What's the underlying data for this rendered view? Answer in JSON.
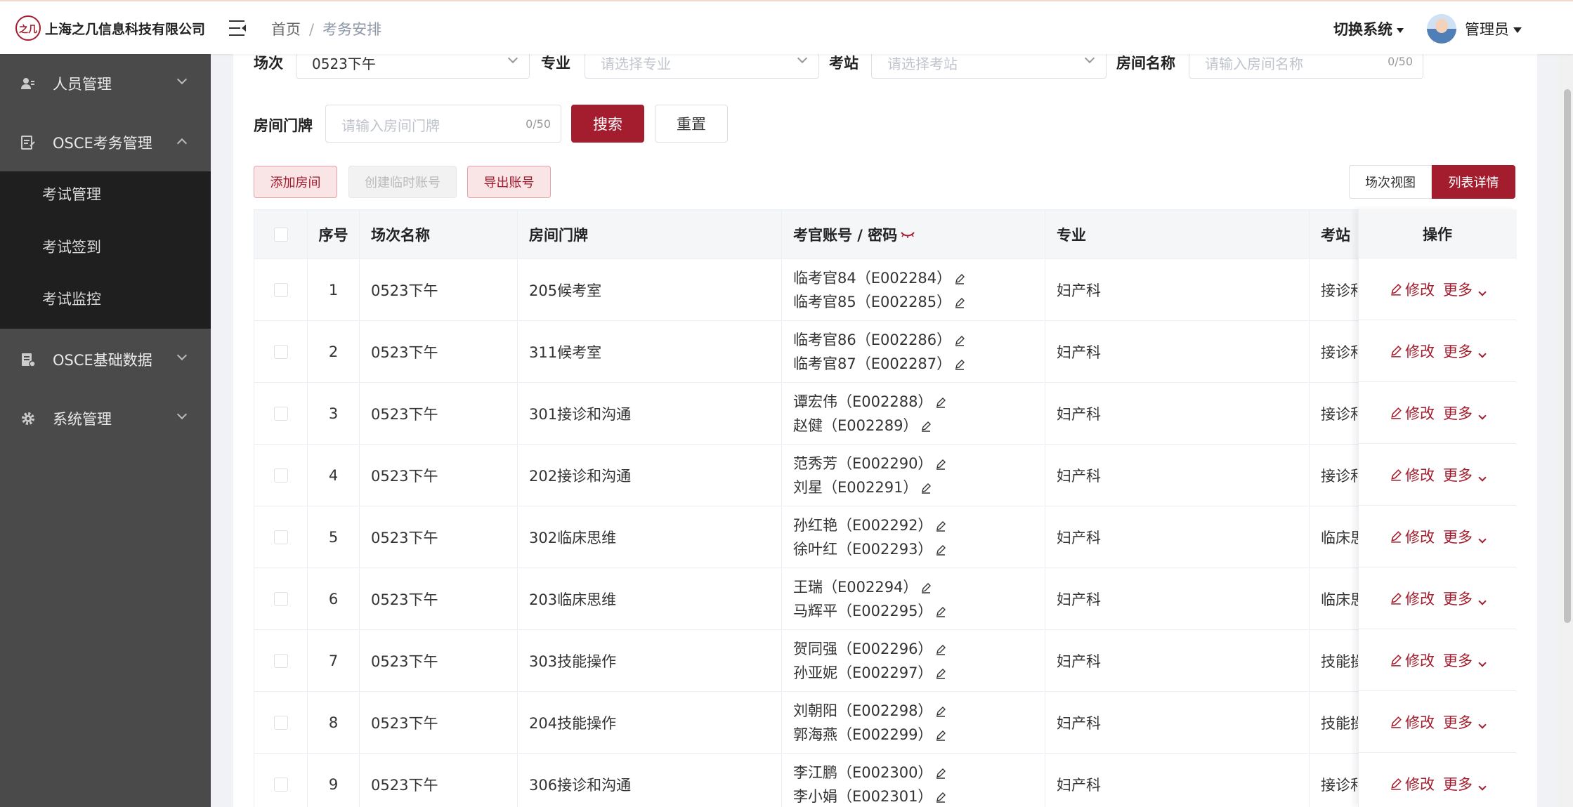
{
  "header": {
    "logo_mark": "之几",
    "company": "上海之几信息科技有限公司",
    "breadcrumb_home": "首页",
    "breadcrumb_sep": "/",
    "breadcrumb_current": "考务安排",
    "switch_system": "切换系统",
    "user": "管理员"
  },
  "sidebar": {
    "menus": [
      {
        "label": "人员管理",
        "icon": "users-icon"
      },
      {
        "label": "OSCE考务管理",
        "icon": "clipboard-icon"
      },
      {
        "label": "OSCE基础数据",
        "icon": "database-icon"
      },
      {
        "label": "系统管理",
        "icon": "gear-icon"
      }
    ],
    "submenu": [
      "考试管理",
      "考试签到",
      "考试监控"
    ]
  },
  "filters": {
    "session_label": "场次",
    "session_value": "0523下午",
    "major_label": "专业",
    "major_placeholder": "请选择专业",
    "station_label": "考站",
    "station_placeholder": "请选择考站",
    "room_name_label": "房间名称",
    "room_name_placeholder": "请输入房间名称",
    "room_name_count": "0/50",
    "room_plate_label": "房间门牌",
    "room_plate_placeholder": "请输入房间门牌",
    "room_plate_count": "0/50",
    "search": "搜索",
    "reset": "重置"
  },
  "actions": {
    "add_room": "添加房间",
    "create_temp": "创建临时账号",
    "export": "导出账号",
    "view_session": "场次视图",
    "view_list": "列表详情"
  },
  "colors": {
    "primary": "#a31d2e",
    "sidebar": "#4a4a4a",
    "submenu": "#1f1f1f"
  },
  "table": {
    "headers": {
      "index": "序号",
      "session": "场次名称",
      "room": "房间门牌",
      "account": "考官账号 / 密码",
      "major": "专业",
      "station": "考站",
      "ops": "操作"
    },
    "edit": "修改",
    "more": "更多",
    "rows": [
      {
        "index": "1",
        "session": "0523下午",
        "room": "205候考室",
        "acc1": "临考官84（E002284）",
        "acc2": "临考官85（E002285）",
        "major": "妇产科",
        "station": "接诊和"
      },
      {
        "index": "2",
        "session": "0523下午",
        "room": "311候考室",
        "acc1": "临考官86（E002286）",
        "acc2": "临考官87（E002287）",
        "major": "妇产科",
        "station": "接诊和"
      },
      {
        "index": "3",
        "session": "0523下午",
        "room": "301接诊和沟通",
        "acc1": "谭宏伟（E002288）",
        "acc2": "赵健（E002289）",
        "major": "妇产科",
        "station": "接诊和"
      },
      {
        "index": "4",
        "session": "0523下午",
        "room": "202接诊和沟通",
        "acc1": "范秀芳（E002290）",
        "acc2": "刘星（E002291）",
        "major": "妇产科",
        "station": "接诊和"
      },
      {
        "index": "5",
        "session": "0523下午",
        "room": "302临床思维",
        "acc1": "孙红艳（E002292）",
        "acc2": "徐叶红（E002293）",
        "major": "妇产科",
        "station": "临床思"
      },
      {
        "index": "6",
        "session": "0523下午",
        "room": "203临床思维",
        "acc1": "王瑞（E002294）",
        "acc2": "马辉平（E002295）",
        "major": "妇产科",
        "station": "临床思"
      },
      {
        "index": "7",
        "session": "0523下午",
        "room": "303技能操作",
        "acc1": "贺同强（E002296）",
        "acc2": "孙亚妮（E002297）",
        "major": "妇产科",
        "station": "技能操"
      },
      {
        "index": "8",
        "session": "0523下午",
        "room": "204技能操作",
        "acc1": "刘朝阳（E002298）",
        "acc2": "郭海燕（E002299）",
        "major": "妇产科",
        "station": "技能操"
      },
      {
        "index": "9",
        "session": "0523下午",
        "room": "306接诊和沟通",
        "acc1": "李江鹏（E002300）",
        "acc2": "李小娟（E002301）",
        "major": "妇产科",
        "station": "接诊和"
      }
    ]
  }
}
